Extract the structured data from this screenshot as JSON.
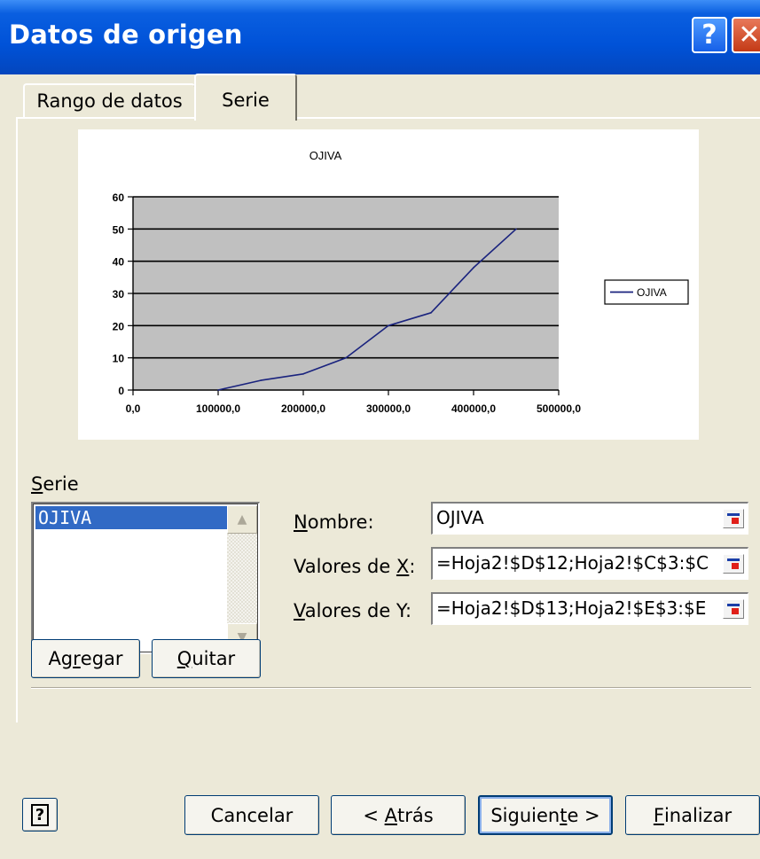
{
  "window": {
    "title": "Datos de origen",
    "help_glyph": "?",
    "close_glyph": "✕"
  },
  "tabs": [
    {
      "label": "Rango de datos"
    },
    {
      "label": "Serie"
    }
  ],
  "chart_data": {
    "type": "line",
    "title": "OJIVA",
    "series": [
      {
        "name": "OJIVA",
        "color": "#1a237e",
        "x": [
          100000,
          150000,
          200000,
          250000,
          300000,
          350000,
          400000,
          450000
        ],
        "values": [
          0,
          3,
          5,
          10,
          20,
          24,
          38,
          50
        ]
      }
    ],
    "xlim": [
      0,
      500000
    ],
    "ylim": [
      0,
      60
    ],
    "xtick_labels": [
      "0,0",
      "100000,0",
      "200000,0",
      "300000,0",
      "400000,0",
      "500000,0"
    ],
    "ytick_labels": [
      "0",
      "10",
      "20",
      "30",
      "40",
      "50",
      "60"
    ],
    "plot_background": "#c0c0c0",
    "grid": "horizontal",
    "legend": "right"
  },
  "serie_section": {
    "label_first": "S",
    "label_rest": "erie",
    "items": [
      "OJIVA"
    ],
    "scroll_up": "▲",
    "scroll_down": "▼",
    "add_button": {
      "pre": "Ag",
      "u": "r",
      "post": "egar"
    },
    "remove_button": {
      "pre": "",
      "u": "Q",
      "post": "uitar"
    }
  },
  "fields": {
    "nombre": {
      "label_u": "N",
      "label_rest": "ombre:",
      "value": "OJIVA"
    },
    "valores_x": {
      "label_pre": "Valores de ",
      "label_u": "X",
      "label_post": ":",
      "value": "=Hoja2!$D$12;Hoja2!$C$3:$C"
    },
    "valores_y": {
      "label_u": "V",
      "label_rest": "alores de Y:",
      "value": "=Hoja2!$D$13;Hoja2!$E$3:$E"
    }
  },
  "footer": {
    "help_glyph": "?",
    "cancel": "Cancelar",
    "back": {
      "pre": "< ",
      "u": "A",
      "post": "trás"
    },
    "next": {
      "pre": "Siguien",
      "u": "t",
      "post": "e >"
    },
    "finish": {
      "u": "F",
      "post": "inalizar"
    }
  }
}
